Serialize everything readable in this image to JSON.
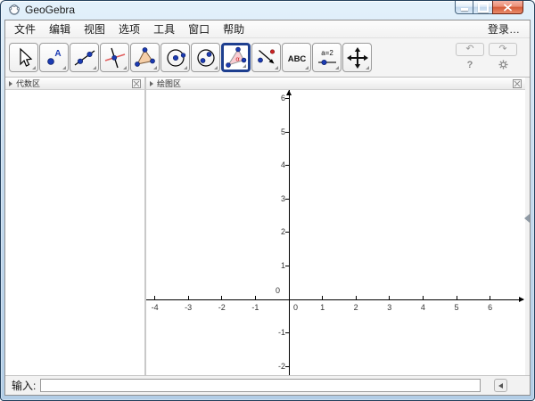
{
  "window": {
    "title": "GeoGebra"
  },
  "menubar": {
    "items": [
      {
        "id": "file",
        "label": "文件"
      },
      {
        "id": "edit",
        "label": "编辑"
      },
      {
        "id": "view",
        "label": "视图"
      },
      {
        "id": "options",
        "label": "选项"
      },
      {
        "id": "tools",
        "label": "工具"
      },
      {
        "id": "window",
        "label": "窗口"
      },
      {
        "id": "help",
        "label": "帮助"
      }
    ],
    "login_label": "登录…"
  },
  "toolbar": {
    "tools": [
      "move",
      "point",
      "line",
      "perpendicular-line",
      "polygon",
      "circle",
      "ellipse",
      "angle",
      "reflection",
      "text",
      "slider",
      "move-graphics-view"
    ],
    "selected_tool": "angle",
    "text_tool_label": "ABC",
    "slider_tool_label": "a=2",
    "angle_symbol": "α",
    "point_label": "A",
    "help_label": "?"
  },
  "panels": {
    "algebra": {
      "title": "代数区"
    },
    "graphics": {
      "title": "绘图区"
    }
  },
  "graphics_view": {
    "x_ticks": [
      -4,
      -3,
      -2,
      -1,
      1,
      2,
      3,
      4,
      5,
      6
    ],
    "y_ticks": [
      6,
      5,
      4,
      3,
      2,
      1,
      -1,
      -2
    ],
    "origin_label_above": "0",
    "origin_label_below": "0"
  },
  "input_bar": {
    "label": "输入:",
    "value": ""
  }
}
